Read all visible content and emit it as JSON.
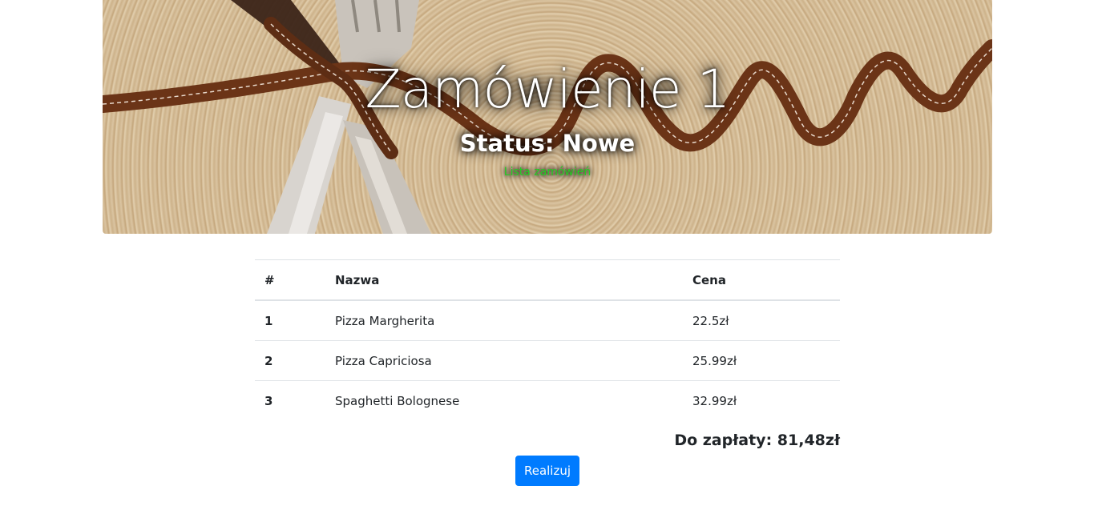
{
  "hero": {
    "title": "Zamówienie 1",
    "status": "Status: Nowe",
    "link_label": "Lista zamówień",
    "link_color": "#22cc22"
  },
  "table": {
    "headers": [
      "#",
      "Nazwa",
      "Cena"
    ],
    "rows": [
      {
        "idx": "1",
        "name": "Pizza Margherita",
        "price": "22.5zł"
      },
      {
        "idx": "2",
        "name": "Pizza Capriciosa",
        "price": "25.99zł"
      },
      {
        "idx": "3",
        "name": "Spaghetti Bolognese",
        "price": "32.99zł"
      }
    ]
  },
  "summary": {
    "total": "Do zapłaty: 81,48zł"
  },
  "actions": {
    "submit_label": "Realizuj",
    "accent": "#007bff"
  }
}
